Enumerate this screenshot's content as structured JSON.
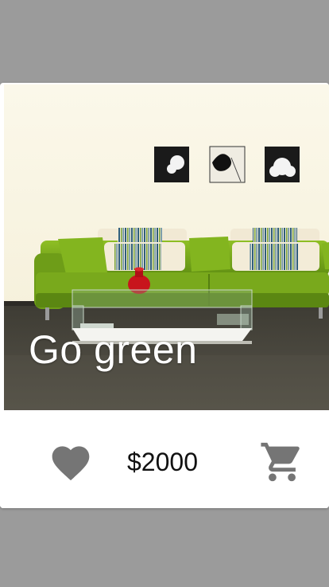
{
  "product": {
    "title": "Go green",
    "price": "$2000",
    "image_name": "living-room-green-sofa-photo"
  },
  "actions": {
    "favorite_icon": "heart-icon",
    "cart_icon": "shopping-cart-icon"
  },
  "colors": {
    "background": "#9b9b9b",
    "card": "#ffffff",
    "icon": "#757575",
    "sofa": "#7fad1e"
  }
}
